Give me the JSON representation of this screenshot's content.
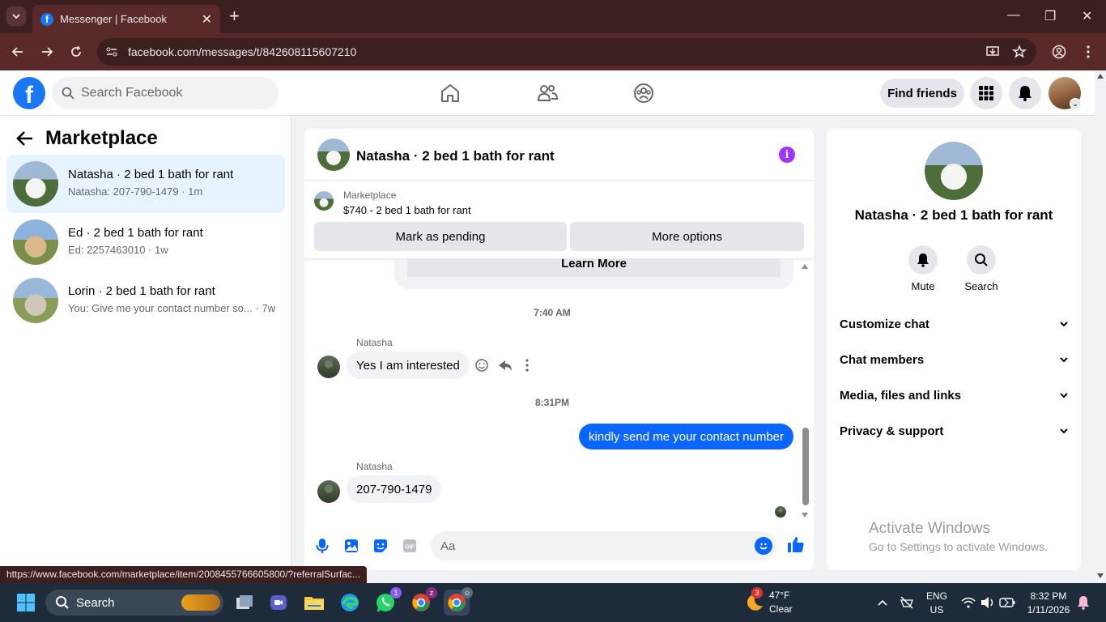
{
  "browser": {
    "tab_title": "Messenger | Facebook",
    "url": "facebook.com/messages/t/842608115607210",
    "status_url": "https://www.facebook.com/marketplace/item/2008455766605800/?referralSurfac..."
  },
  "header": {
    "search_placeholder": "Search Facebook",
    "find_friends": "Find friends"
  },
  "sidebar": {
    "title": "Marketplace",
    "conversations": [
      {
        "title": "Natasha · 2 bed 1 bath for rant",
        "subtitle": "Natasha: 207-790-1479 · 1m",
        "active": true
      },
      {
        "title": "Ed · 2 bed 1 bath for rant",
        "subtitle": "Ed: 2257463010 · 1w",
        "active": false
      },
      {
        "title": "Lorin · 2 bed 1 bath for rant",
        "subtitle": "You: Give me your contact number so... · 7w",
        "active": false
      }
    ]
  },
  "chat": {
    "title": "Natasha · 2 bed 1 bath for rant",
    "marketplace_label": "Marketplace",
    "listing": "$740 - 2 bed 1 bath for rant",
    "mark_pending": "Mark as pending",
    "more_options": "More options",
    "learn_more": "Learn More",
    "messages": [
      {
        "type": "time",
        "text": "7:40 AM"
      },
      {
        "type": "in",
        "sender": "Natasha",
        "text": "Yes I am interested"
      },
      {
        "type": "time",
        "text": "8:31PM"
      },
      {
        "type": "out",
        "text": "kindly send me your contact number"
      },
      {
        "type": "in",
        "sender": "Natasha",
        "text": "207-790-1479"
      }
    ],
    "composer_placeholder": "Aa"
  },
  "right_panel": {
    "name": "Natasha · 2 bed 1 bath for rant",
    "mute": "Mute",
    "search": "Search",
    "sections": [
      "Customize chat",
      "Chat members",
      "Media, files and links",
      "Privacy & support"
    ],
    "activate_title": "Activate Windows",
    "activate_sub": "Go to Settings to activate Windows."
  },
  "taskbar": {
    "search": "Search",
    "weather_temp": "47°F",
    "weather_desc": "Clear",
    "weather_badge": "3",
    "lang1": "ENG",
    "lang2": "US",
    "time": "8:32 PM",
    "date": "1/11/2026",
    "whatsapp_badge": "1"
  },
  "colors": {
    "fb_blue": "#1877f2",
    "messenger_blue": "#0a66ff",
    "info_purple": "#a033ff",
    "browser_frame": "#5a2a2a"
  }
}
